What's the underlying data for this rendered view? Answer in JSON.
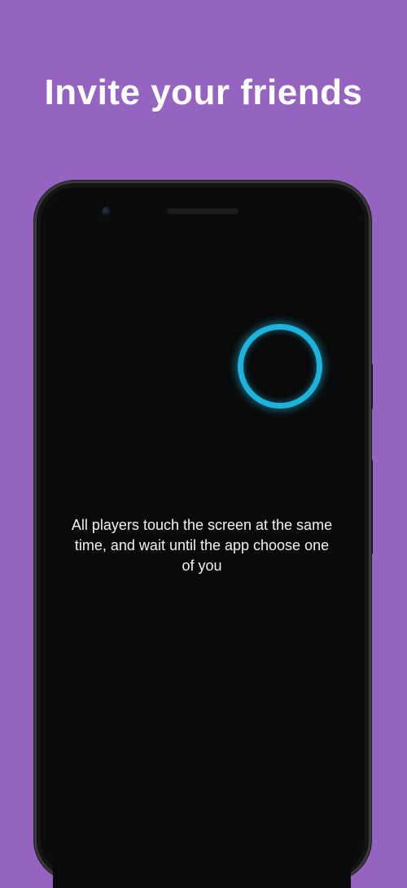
{
  "headline": "Invite your friends",
  "screen": {
    "instruction": "All players touch the screen at the same time, and wait until the app choose one of you",
    "touch_indicator_color": "#1cb4dc"
  },
  "colors": {
    "background": "#9564c0",
    "phone_body": "#0b0b0b",
    "screen": "#0a0a0a",
    "text": "#ffffff"
  }
}
